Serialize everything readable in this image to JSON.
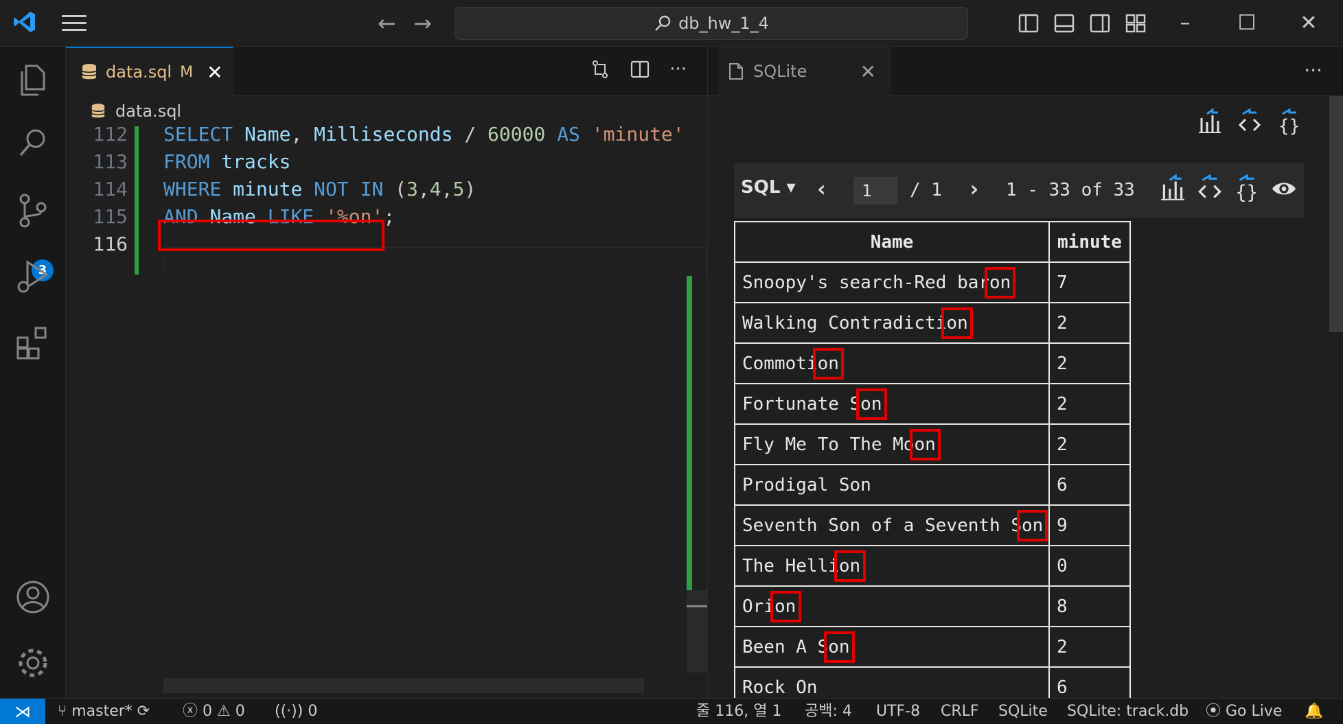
{
  "titlebar": {
    "search_text": "db_hw_1_4",
    "back_icon": "arrow-left-icon",
    "forward_icon": "arrow-right-icon"
  },
  "activitybar": {
    "items": [
      "explorer-icon",
      "search-icon",
      "source-control-icon",
      "run-debug-icon",
      "extensions-icon"
    ],
    "source_control_badge": "3",
    "bottom": [
      "account-icon",
      "settings-gear-icon"
    ]
  },
  "editor": {
    "tab": {
      "filename": "data.sql",
      "status": "M"
    },
    "breadcrumb": "data.sql",
    "lines": [
      {
        "number": "112",
        "tokens": [
          {
            "t": "SELECT ",
            "c": "kw"
          },
          {
            "t": "Name",
            "c": "id"
          },
          {
            "t": ", ",
            "c": "pl"
          },
          {
            "t": "Milliseconds",
            "c": "id"
          },
          {
            "t": " / ",
            "c": "pl"
          },
          {
            "t": "60000",
            "c": "num"
          },
          {
            "t": " AS ",
            "c": "kw"
          },
          {
            "t": "'minute'",
            "c": "str"
          }
        ]
      },
      {
        "number": "113",
        "tokens": [
          {
            "t": "FROM ",
            "c": "kw"
          },
          {
            "t": "tracks",
            "c": "id"
          }
        ]
      },
      {
        "number": "114",
        "tokens": [
          {
            "t": "WHERE ",
            "c": "kw"
          },
          {
            "t": "minute",
            "c": "id"
          },
          {
            "t": " NOT IN ",
            "c": "kw"
          },
          {
            "t": "(",
            "c": "pl"
          },
          {
            "t": "3",
            "c": "num"
          },
          {
            "t": ",",
            "c": "pl"
          },
          {
            "t": "4",
            "c": "num"
          },
          {
            "t": ",",
            "c": "pl"
          },
          {
            "t": "5",
            "c": "num"
          },
          {
            "t": ")",
            "c": "pl"
          }
        ]
      },
      {
        "number": "115",
        "tokens": [
          {
            "t": "AND ",
            "c": "kw"
          },
          {
            "t": "Name",
            "c": "id"
          },
          {
            "t": " LIKE ",
            "c": "kw"
          },
          {
            "t": "'%on'",
            "c": "str"
          },
          {
            "t": ";",
            "c": "pl"
          }
        ]
      },
      {
        "number": "116",
        "tokens": []
      }
    ]
  },
  "sqlite_panel": {
    "tab_label": "SQLite",
    "dropdown": "SQL ▾",
    "page_current": "1",
    "page_total": "/ 1",
    "range_text": "1 - 33 of 33",
    "columns": [
      "Name",
      "minute"
    ],
    "rows": [
      [
        "Snoopy's search-Red baron",
        "7"
      ],
      [
        "Walking Contradiction",
        "2"
      ],
      [
        "Commotion",
        "2"
      ],
      [
        "Fortunate Son",
        "2"
      ],
      [
        "Fly Me To The Moon",
        "2"
      ],
      [
        "Prodigal Son",
        "6"
      ],
      [
        "Seventh Son of a Seventh Son",
        "9"
      ],
      [
        "The Hellion",
        "0"
      ],
      [
        "Orion",
        "8"
      ],
      [
        "Been A Son",
        "2"
      ],
      [
        "Rock On",
        "6"
      ]
    ]
  },
  "statusbar": {
    "branch": "master*",
    "errors": "0",
    "warnings": "0",
    "ports": "0",
    "position": "줄 116, 열 1",
    "spaces": "공백: 4",
    "encoding": "UTF-8",
    "eol": "CRLF",
    "language": "SQLite",
    "db": "SQLite: track.db",
    "golive": "Go Live"
  },
  "colors": {
    "accent": "#0078d4",
    "highlight": "#e00000",
    "modified": "#2ea043"
  }
}
